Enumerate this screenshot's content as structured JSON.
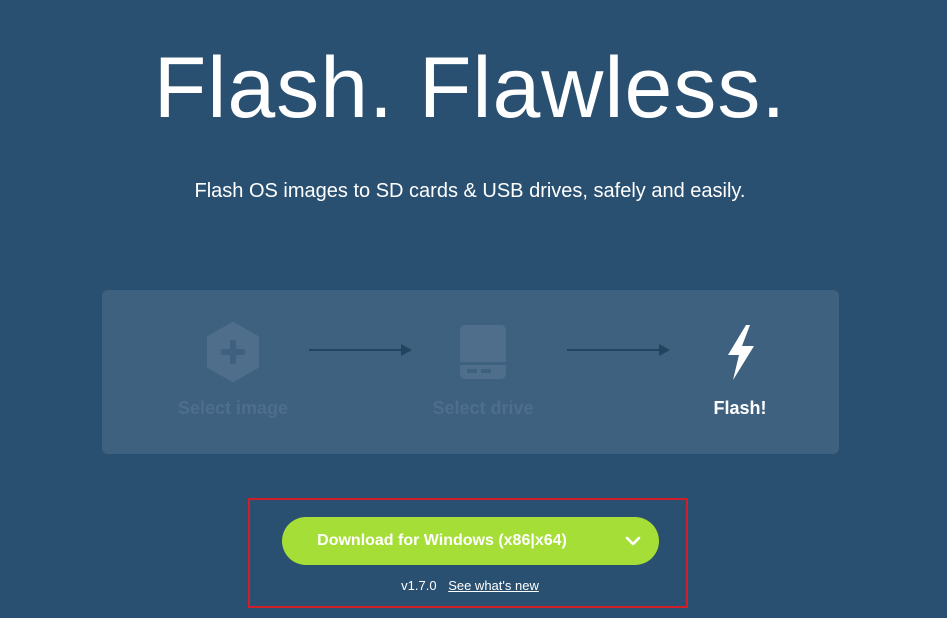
{
  "hero": {
    "title": "Flash. Flawless.",
    "subtitle": "Flash OS images to SD cards & USB drives, safely and easily."
  },
  "steps": [
    {
      "label": "Select image",
      "icon": "plus-hexagon-icon",
      "state": "disabled"
    },
    {
      "label": "Select drive",
      "icon": "drive-icon",
      "state": "disabled"
    },
    {
      "label": "Flash!",
      "icon": "lightning-bolt-icon",
      "state": "active"
    }
  ],
  "download": {
    "button_label": "Download for Windows (x86|x64)",
    "dropdown_icon": "chevron-down-icon",
    "version": "v1.7.0",
    "whats_new_link": "See what's new"
  },
  "colors": {
    "background": "#2a5071",
    "panel": "#3e6180",
    "disabled_step": "#4e6e8b",
    "accent_button": "#a5de37",
    "highlight_frame": "#d11f2a"
  }
}
